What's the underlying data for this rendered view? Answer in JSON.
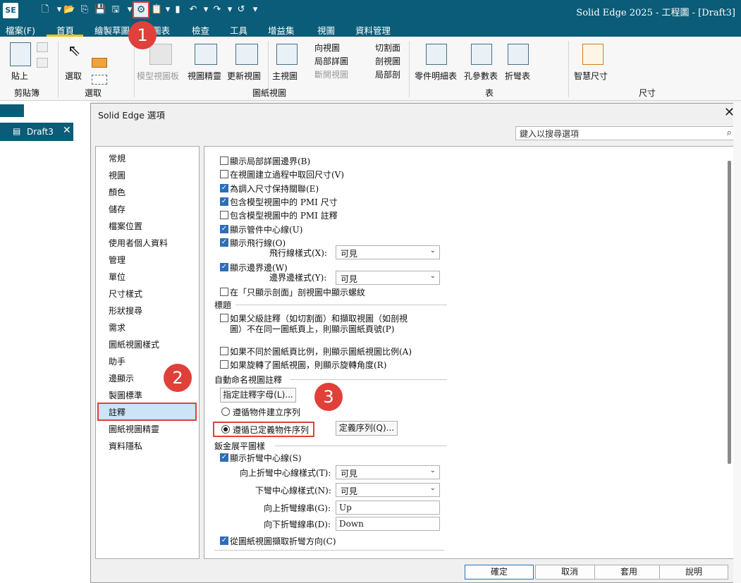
{
  "app": {
    "logo": "SE",
    "window_title": "Solid Edge 2025 - 工程圖 - [Draft3]"
  },
  "menu": {
    "tabs": [
      "檔案(F)",
      "首頁",
      "繪製草圖",
      "圖表",
      "檢查",
      "工具",
      "增益集",
      "視圖",
      "資料管理"
    ]
  },
  "ribbon": {
    "paste": "貼上",
    "clipboard_group": "剪貼簿",
    "select": "選取",
    "select_group": "選取",
    "model_view_board": "模型視圖板",
    "view_wizard": "視圖精靈",
    "update_views": "更新視圖",
    "principal_view": "主視圖",
    "auxiliary_view": "向視圖",
    "detail_view": "局部詳圖",
    "broken_view": "斷開視圖",
    "cutting_plane": "切割面",
    "section_view": "剖視圖",
    "broken_out": "局部剖",
    "drawing_views_group": "圖紙視圖",
    "parts_list": "零件明細表",
    "hole_table": "孔參數表",
    "bend_table": "折彎表",
    "tables_group": "表",
    "smart_dimension": "智慧尺寸",
    "dimension_group": "尺寸"
  },
  "document": {
    "tab_label": "Draft3",
    "close_icon": "close-icon"
  },
  "dialog": {
    "title": "Solid Edge 選項",
    "search_placeholder": "鍵入以搜尋選項",
    "nav_items": [
      "常規",
      "視圖",
      "顏色",
      "儲存",
      "檔案位置",
      "使用者個人資料",
      "管理",
      "單位",
      "尺寸樣式",
      "形狀搜尋",
      "需求",
      "圖紙視圖樣式",
      "助手",
      "邊顯示",
      "製圖標準",
      "註釋",
      "圖紙視圖精靈",
      "資料隱私"
    ],
    "selected_nav": "註釋",
    "options": {
      "show_detail_border": "顯示局部詳圖邊界(B)",
      "retrieve_dims": "在視圖建立過程中取回尺寸(V)",
      "keep_dims_linked": "為調入尺寸保持關聯(E)",
      "include_pmi_dims": "包含模型視圖中的 PMI 尺寸",
      "include_pmi_annot": "包含模型視圖中的 PMI 註釋",
      "show_tube_centerline": "顯示管件中心線(U)",
      "show_flowline": "顯示飛行線(O)",
      "flowline_style_label": "飛行線樣式(X):",
      "flowline_style_value": "可見",
      "show_border_edges": "顯示邊界邊(W)",
      "border_style_label": "邊界邊樣式(Y):",
      "border_style_value": "可見",
      "thread_only_section": "在「只顯示剖面」剖視圖中顯示螺紋"
    },
    "caption_section": {
      "title": "標題",
      "parent_annotation_line1": "如果父級註釋（如切割面）和擷取視圖（如剖視",
      "parent_annotation_line2": "圖）不在同一圖紙頁上，則顯示圖紙頁號(P)",
      "show_scale": "如果不同於圖紙頁比例，則顯示圖紙視圖比例(A)",
      "show_rotation": "如果旋轉了圖紙視圖，則顯示旋轉角度(R)"
    },
    "auto_name_section": {
      "title": "自動命名視圖註釋",
      "specify_letters_btn": "指定註釋字母(L)...",
      "follow_creation": "遵循物件建立序列",
      "follow_defined": "遵循已定義物件序列",
      "define_sequence_btn": "定義序列(Q)..."
    },
    "flat_section": {
      "title": "鈑金展平圖樣",
      "show_bend_centerline": "顯示折彎中心線(S)",
      "up_bend_style_label": "向上折彎中心線樣式(T):",
      "up_bend_style_value": "可見",
      "down_bend_style_label": "下彎中心線樣式(N):",
      "down_bend_style_value": "可見",
      "up_bend_string_label": "向上折彎線串(G):",
      "up_bend_string_value": "Up",
      "down_bend_string_label": "向下折彎線串(D):",
      "down_bend_string_value": "Down",
      "bend_dir_from_view": "從圖紙視圖擷取折彎方向(C)"
    },
    "footer": {
      "ok": "確定",
      "cancel": "取消",
      "apply": "套用",
      "help": "說明"
    }
  },
  "annotations": {
    "step1": "1",
    "step2": "2",
    "step3": "3"
  },
  "colors": {
    "titlebar": "#0b5c78",
    "highlight": "#e0403a",
    "selection": "#cce4f7",
    "checkbox": "#2c6fb7"
  }
}
